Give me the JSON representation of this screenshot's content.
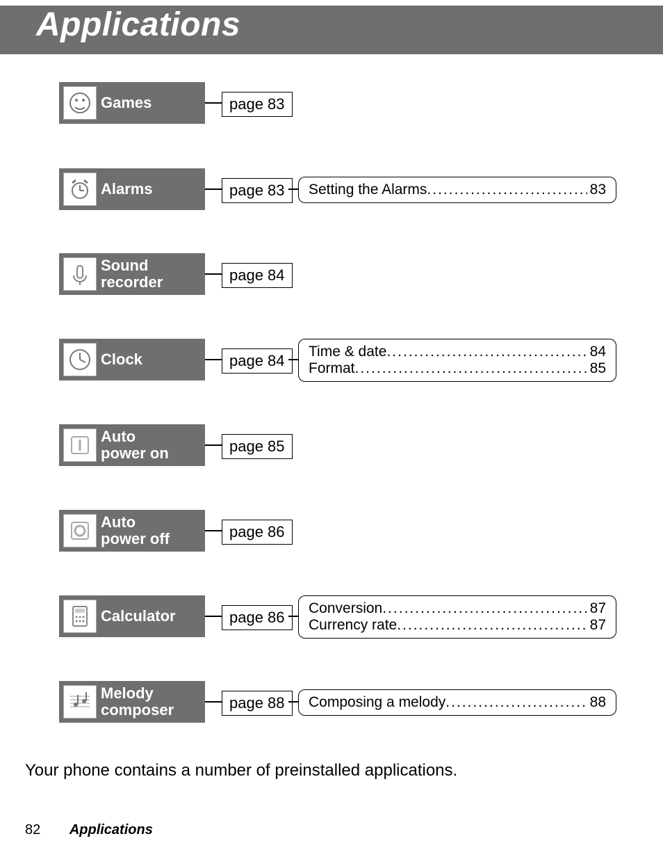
{
  "title": "Applications",
  "apps": [
    {
      "id": "games",
      "label": "Games",
      "page_ref": "page 83",
      "subs": []
    },
    {
      "id": "alarms",
      "label": "Alarms",
      "page_ref": "page 83",
      "subs": [
        {
          "label": "Setting the Alarms",
          "page": "83"
        }
      ]
    },
    {
      "id": "sound-recorder",
      "label": "Sound\nrecorder",
      "page_ref": "page 84",
      "subs": []
    },
    {
      "id": "clock",
      "label": "Clock",
      "page_ref": "page 84",
      "subs": [
        {
          "label": "Time & date",
          "page": "84"
        },
        {
          "label": "Format",
          "page": "85"
        }
      ]
    },
    {
      "id": "auto-power-on",
      "label": "Auto\npower on",
      "page_ref": "page 85",
      "subs": []
    },
    {
      "id": "auto-power-off",
      "label": "Auto\npower off",
      "page_ref": "page 86",
      "subs": []
    },
    {
      "id": "calculator",
      "label": "Calculator",
      "page_ref": "page 86",
      "subs": [
        {
          "label": "Conversion",
          "page": "87"
        },
        {
          "label": "Currency rate",
          "page": "87"
        }
      ]
    },
    {
      "id": "melody-composer",
      "label": "Melody\ncomposer",
      "page_ref": "page 88",
      "subs": [
        {
          "label": "Composing a melody",
          "page": "88"
        }
      ]
    }
  ],
  "body_text": "Your phone contains a number of preinstalled applications.",
  "footer": {
    "page_number": "82",
    "chapter": "Applications"
  }
}
